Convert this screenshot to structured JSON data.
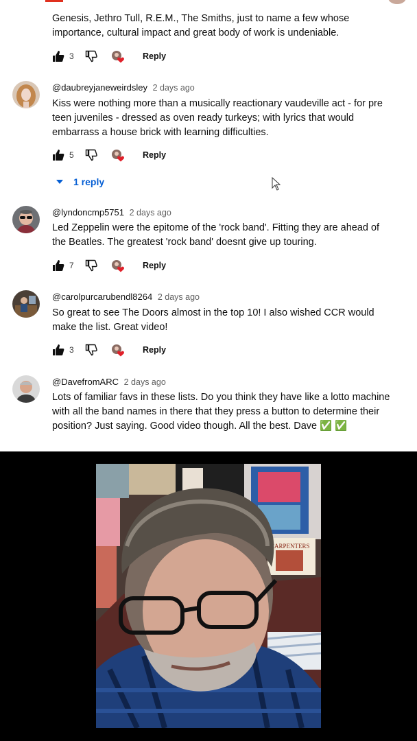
{
  "comments": [
    {
      "author": "",
      "time": "",
      "text": "Genesis, Jethro Tull, R.E.M., The Smiths, just to name a few whose importance, cultural impact and great body of work is undeniable.",
      "likes": "3",
      "reply_label": "Reply"
    },
    {
      "author": "@daubreyjaneweirdsley",
      "time": "2 days ago",
      "text": "Kiss were nothing more than a musically reactionary vaudeville act - for pre teen juveniles - dressed as oven ready turkeys; with lyrics that would embarrass a house brick with learning difficulties.",
      "likes": "5",
      "reply_label": "Reply",
      "replies_label": "1 reply"
    },
    {
      "author": "@lyndoncmp5751",
      "time": "2 days ago",
      "text": "Led Zeppelin were the epitome of the 'rock band'. Fitting they are ahead of the Beatles. The greatest 'rock band' doesnt give up touring.",
      "likes": "7",
      "reply_label": "Reply"
    },
    {
      "author": "@carolpurcarubendl8264",
      "time": "2 days ago",
      "text": "So great to see The Doors almost in the top 10! I also wished CCR would make the list. Great video!",
      "likes": "3",
      "reply_label": "Reply"
    },
    {
      "author": "@DavefromARC",
      "time": "2 days ago",
      "text": "Lots of familiar favs in these lists. Do you think they have like a lotto machine with all the band names in there that they press a button to determine their position? Just saying. Good video though. All the best. Dave",
      "emoji": "✅ ✅"
    }
  ],
  "video": {
    "poster_text": "CARPENTERS"
  },
  "icons": {
    "like": "thumbs-up-icon",
    "dislike": "thumbs-down-icon",
    "creator_heart": "creator-heart-icon",
    "expand": "caret-down-icon",
    "cursor": "mouse-cursor-icon"
  },
  "colors": {
    "link_blue": "#065fd4",
    "heart_red": "#e0202a",
    "checkmark_green": "#69c35b"
  }
}
